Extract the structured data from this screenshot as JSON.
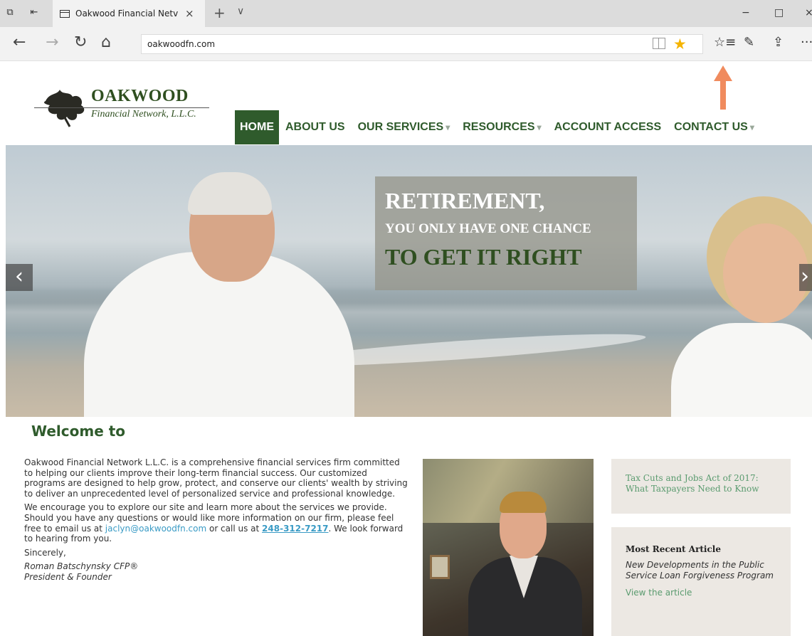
{
  "browser": {
    "tab_title": "Oakwood Financial Netv",
    "tab_close": "×",
    "new_tab": "+",
    "tab_menu": "∨",
    "window_controls": {
      "minimize": "−",
      "maximize": "□",
      "close": "×"
    },
    "nav": {
      "back": "←",
      "forward": "→",
      "refresh": "↻",
      "home": "⌂"
    },
    "url": "oakwoodfn.com",
    "favorite_star": "★",
    "toolbar": {
      "hub": "☆≡",
      "notes": "✎",
      "share": "⇪",
      "more": "···"
    },
    "annotation_arrow_color": "#f08b5e"
  },
  "site": {
    "logo": {
      "name": "OAKWOOD",
      "subtitle": "Financial Network, L.L.C."
    },
    "nav": {
      "home": "HOME",
      "about": "ABOUT US",
      "services": "OUR SERVICES",
      "resources": "RESOURCES",
      "account": "ACCOUNT ACCESS",
      "contact": "CONTACT US",
      "dropdown_caret": "▾"
    },
    "hero": {
      "line1": "RETIREMENT,",
      "line2": "YOU ONLY HAVE ONE CHANCE",
      "line3": "TO GET IT RIGHT",
      "prev": "‹",
      "next": "›"
    },
    "welcome_heading": "Welcome to",
    "intro": {
      "p1": "Oakwood Financial Network L.L.C. is a comprehensive financial services firm committed to helping our clients improve their long-term financial success. Our customized programs are designed to help grow, protect, and conserve our clients' wealth by striving to deliver an unprecedented level of personalized service and professional knowledge.",
      "p2_before": "We encourage you to explore our site and learn more about the services we provide. Should you have any questions or would like more information on our firm, please feel free to email us at ",
      "email": "jaclyn@oakwoodfn.com",
      "p2_mid": " or call us at ",
      "phone": "248-312-7217",
      "p2_after": ". We look forward to hearing from you.",
      "closing": "Sincerely,",
      "signature_name": "Roman Batschynsky CFP®",
      "signature_title": "President & Founder"
    },
    "sidebar": {
      "tax_link": "Tax Cuts and Jobs Act of 2017: What Taxpayers Need to Know",
      "recent_heading": "Most Recent Article",
      "recent_title": "New Developments in the Public Service Loan Forgiveness Program",
      "recent_link": "View the article"
    },
    "colors": {
      "brand_green": "#2f5b2c",
      "link_blue": "#3a9bc5",
      "sidebar_bg": "#ece8e3",
      "sidebar_link": "#5a9b6f"
    }
  }
}
